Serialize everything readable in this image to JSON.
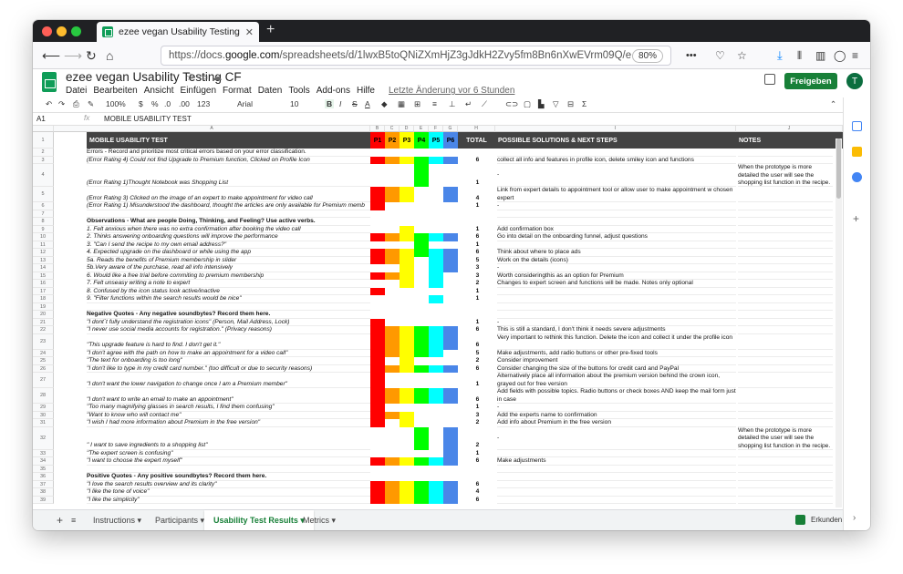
{
  "browser": {
    "tab_title": "ezee vegan Usability Testing CF",
    "url_prefix": "https://docs.",
    "url_domain": "google.com",
    "url_rest": "/spreadsheets/d/1lwxB5toQNiZXmHjZ3gJdkH2Zvy5fm8Bn6nXwEVrm09Q/e",
    "zoom": "80%"
  },
  "sheets": {
    "doc_title": "ezee vegan Usability Testing CF",
    "menus": [
      "Datei",
      "Bearbeiten",
      "Ansicht",
      "Einfügen",
      "Format",
      "Daten",
      "Tools",
      "Add-ons",
      "Hilfe"
    ],
    "last_edit": "Letzte Änderung vor 6 Stunden",
    "share_label": "Freigeben",
    "avatar_letter": "T",
    "toolbar_zoom": "100%",
    "toolbar_currency": "$",
    "toolbar_percent": "%",
    "toolbar_dec": ".0",
    "toolbar_dec2": ".00",
    "toolbar_fmt": "123",
    "font_name": "Arial",
    "font_size": "10",
    "bold": "B",
    "italic": "I",
    "strike": "S",
    "text_color": "A",
    "cell_ref": "A1",
    "formula_value": "MOBILE USABILITY TEST"
  },
  "grid": {
    "col_letters": [
      "A",
      "B",
      "C",
      "D",
      "E",
      "F",
      "G",
      "H",
      "I",
      "J"
    ],
    "headers": {
      "a": "MOBILE USABILITY TEST",
      "p": [
        "P1",
        "P2",
        "P3",
        "P4",
        "P5",
        "P6"
      ],
      "total": "TOTAL",
      "solutions": "POSSIBLE SOLUTIONS & NEXT STEPS",
      "notes": "NOTES"
    },
    "p_colors": [
      "#ff0000",
      "#ff9900",
      "#ffff00",
      "#00ff00",
      "#00ffff",
      "#4a86e8"
    ],
    "rows": [
      {
        "n": "2",
        "a": "Errors - Record and prioritize most critical errors based on your error classification.",
        "a_bold_prefix": "Errors",
        "p": [],
        "t": "",
        "i": "",
        "j": "",
        "h": 8.5
      },
      {
        "n": "3",
        "a": "(Error Rating 4) Could not find Upgrade to Premium function, Clicked on Profile Icon",
        "it": true,
        "p": [
          1,
          1,
          1,
          1,
          1,
          1
        ],
        "t": "6",
        "i": "collect all info and features in profile icon, delete smiley icon and functions",
        "j": "",
        "h": 8.5
      },
      {
        "n": "4",
        "a": "(Error Rating 1)Thought Notebook was Shopping List",
        "it": true,
        "p": [
          0,
          0,
          0,
          1,
          0,
          0
        ],
        "t": "1",
        "i": "-",
        "j": "When the prototype is more detailed the user will see the shopping list function in the recipe.",
        "h": 25
      },
      {
        "n": "5",
        "a": "(Error Rating 3) Clicked on the image of an expert to make appointment for video call",
        "it": true,
        "p": [
          1,
          1,
          1,
          0,
          0,
          1
        ],
        "t": "4",
        "i": "Link from expert details to appointment tool or allow user to make appointment w chosen expert",
        "j": "",
        "h": 17
      },
      {
        "n": "6",
        "a": "(Error Rating 1) Misunderstood the dashboard, thought the articles are only available for Premium memb",
        "it": true,
        "p": [
          1,
          0,
          0,
          0,
          0,
          0
        ],
        "t": "1",
        "i": "-",
        "j": "",
        "h": 8.5
      },
      {
        "n": "7",
        "a": "",
        "p": [],
        "t": "",
        "i": "",
        "j": "",
        "h": 8.5
      },
      {
        "n": "8",
        "a": "Observations - What are people Doing, Thinking, and Feeling? Use active verbs.",
        "b": true,
        "p": [],
        "t": "",
        "i": "",
        "j": "",
        "h": 8.5
      },
      {
        "n": "9",
        "a": "1. Felt anxious when there was no extra confirmation after booking the video call",
        "it": true,
        "p": [
          0,
          0,
          1,
          0,
          0,
          0
        ],
        "t": "1",
        "i": "Add confirmation box",
        "j": "",
        "h": 8.5
      },
      {
        "n": "10",
        "a": "2. Thinks answering onboarding questions will improve the performance",
        "it": true,
        "p": [
          1,
          1,
          1,
          1,
          1,
          1
        ],
        "t": "6",
        "i": "Go into detail on the onboarding funnel, adjust questions",
        "j": "",
        "h": 8.5
      },
      {
        "n": "11",
        "a": "3. \"Can I send the recipe to my own email address?\"",
        "it": true,
        "p": [
          0,
          0,
          0,
          1,
          0,
          0
        ],
        "t": "1",
        "i": "",
        "j": "",
        "h": 8.5
      },
      {
        "n": "12",
        "a": "4. Expected upgrade on the dashboard or while using the app",
        "it": true,
        "p": [
          1,
          1,
          1,
          1,
          1,
          1
        ],
        "t": "6",
        "i": "Think about where to place ads",
        "j": "",
        "h": 8.5
      },
      {
        "n": "13",
        "a": "5a. Reads the benefits of Premium membership in slider",
        "it": true,
        "p": [
          1,
          1,
          1,
          0,
          1,
          1
        ],
        "t": "5",
        "i": "Work on the details (icons)",
        "j": "",
        "h": 8.5
      },
      {
        "n": "14",
        "a": "5b.Very aware of the purchase, read all info intensively",
        "it": true,
        "p": [
          0,
          0,
          1,
          0,
          1,
          1
        ],
        "t": "3",
        "i": "-",
        "j": "",
        "h": 8.5
      },
      {
        "n": "15",
        "a": "6. Would like a free trial before commiting to premium membership",
        "it": true,
        "p": [
          1,
          1,
          1,
          0,
          1,
          0
        ],
        "t": "3",
        "i": "Worth consideringthis as an option for Premium",
        "j": "",
        "h": 8.5
      },
      {
        "n": "16",
        "a": "7. Felt unseasy writing a note to expert",
        "it": true,
        "p": [
          0,
          0,
          1,
          0,
          1,
          0
        ],
        "t": "2",
        "i": "Changes to expert screen and functions will be made. Notes only optional",
        "j": "",
        "h": 8.5
      },
      {
        "n": "17",
        "a": "8. Confused by the icon status look active/inactive",
        "it": true,
        "p": [
          1,
          0,
          0,
          0,
          0,
          0
        ],
        "t": "1",
        "i": "",
        "j": "",
        "h": 8.5
      },
      {
        "n": "18",
        "a": "9. \"Filter functions within the search results would be nice\"",
        "it": true,
        "p": [
          0,
          0,
          0,
          0,
          1,
          0
        ],
        "t": "1",
        "i": "",
        "j": "",
        "h": 8.5
      },
      {
        "n": "19",
        "a": "",
        "p": [],
        "t": "",
        "i": "",
        "j": "",
        "h": 8.5
      },
      {
        "n": "20",
        "a": "Negative Quotes - Any negative soundbytes? Record them here.",
        "b": true,
        "p": [],
        "t": "",
        "i": "",
        "j": "",
        "h": 8.5
      },
      {
        "n": "21",
        "a": "\"I dont´t fully understand the registration icons\" (Person, Mail Address, Lock)",
        "it": true,
        "p": [
          1,
          0,
          0,
          0,
          0,
          0
        ],
        "t": "1",
        "i": "-",
        "j": "",
        "h": 8.5
      },
      {
        "n": "22",
        "a": "\"I never use social media accounts for registration.\" (Privacy reasons)",
        "it": true,
        "p": [
          1,
          1,
          1,
          1,
          1,
          1
        ],
        "t": "6",
        "i": "This is still a standard, I don't think it needs severe adjustments",
        "j": "",
        "h": 8.5
      },
      {
        "n": "23",
        "a": "\"This upgrade feature is hard to find. I don't get it.\"",
        "it": true,
        "p": [
          1,
          1,
          1,
          1,
          1,
          1
        ],
        "t": "6",
        "i": "Very important to rethink this function. Delete the icon and collect it under the profile icon",
        "j": "",
        "h": 17
      },
      {
        "n": "24",
        "a": "\"I don't agree with the path on how to make an appointment for a video call\"",
        "it": true,
        "p": [
          1,
          1,
          1,
          1,
          1,
          0
        ],
        "t": "5",
        "i": "Make adjustments, add radio buttons or other pre-fixed tools",
        "j": "",
        "h": 8.5
      },
      {
        "n": "25",
        "a": "\"The text for onboarding is too long\"",
        "it": true,
        "p": [
          1,
          0,
          1,
          0,
          0,
          0
        ],
        "t": "2",
        "i": "Consider improvement",
        "j": "",
        "h": 8.5
      },
      {
        "n": "26",
        "a": "\"I don't like to type in my credit card number.\" (too difficult or due to security reasons)",
        "it": true,
        "p": [
          1,
          1,
          1,
          1,
          1,
          1
        ],
        "t": "6",
        "i": "Consider changing the size of the buttons for credit card and PayPal",
        "j": "",
        "h": 8.5
      },
      {
        "n": "27",
        "a": "\"I don't want the lower navigation to change once I am a Premium member\"",
        "it": true,
        "p": [
          1,
          0,
          0,
          0,
          0,
          0
        ],
        "t": "1",
        "i": "Alternatively place all information about the premium version behind the crown icon, grayed out for free version",
        "j": "",
        "h": 17
      },
      {
        "n": "28",
        "a": "\"I don't want to write an email to make an appointment\"",
        "it": true,
        "p": [
          1,
          1,
          1,
          1,
          1,
          1
        ],
        "t": "6",
        "i": "Add fields with possible topics. Radio buttons or check boxes AND keep the mail form just in case",
        "j": "",
        "h": 17
      },
      {
        "n": "29",
        "a": "\"Too many magnifying glasses in search results, I find them confusing\"",
        "it": true,
        "p": [
          1,
          0,
          0,
          0,
          0,
          0
        ],
        "t": "1",
        "i": "-",
        "j": "",
        "h": 8.5
      },
      {
        "n": "30",
        "a": "\"Want to know who will contact me\"",
        "it": true,
        "p": [
          1,
          1,
          1,
          0,
          0,
          0
        ],
        "t": "3",
        "i": "Add the experts name to confirmation",
        "j": "",
        "h": 8.5
      },
      {
        "n": "31",
        "a": "\"I wish I had more information about Premium in the free version\"",
        "it": true,
        "p": [
          1,
          0,
          1,
          0,
          0,
          0
        ],
        "t": "2",
        "i": "Add info about Premium in the free version",
        "j": "",
        "h": 8.5
      },
      {
        "n": "32",
        "a": "\" I want to save ingredients to a shopping list\"",
        "it": true,
        "p": [
          0,
          0,
          0,
          1,
          0,
          1
        ],
        "t": "2",
        "i": "-",
        "j": "When the prototype is more detailed the user will see the shopping list function in the recipe.",
        "h": 25
      },
      {
        "n": "33",
        "a": "\"The expert screen is confusing\"",
        "it": true,
        "p": [
          0,
          0,
          0,
          0,
          0,
          1
        ],
        "t": "1",
        "i": "",
        "j": "",
        "h": 8.5
      },
      {
        "n": "34",
        "a": "\"I want to choose the expert myself\"",
        "it": true,
        "p": [
          1,
          1,
          1,
          1,
          1,
          1
        ],
        "t": "6",
        "i": "Make adjustments",
        "j": "",
        "h": 8.5
      },
      {
        "n": "35",
        "a": "",
        "p": [],
        "t": "",
        "i": "",
        "j": "",
        "h": 8.5
      },
      {
        "n": "36",
        "a": "Positive Quotes - Any positive soundbytes? Record them here.",
        "b": true,
        "p": [],
        "t": "",
        "i": "",
        "j": "",
        "h": 8.5
      },
      {
        "n": "37",
        "a": "\"I love the search results overview and its clarity\"",
        "it": true,
        "p": [
          1,
          1,
          1,
          1,
          1,
          1
        ],
        "t": "6",
        "i": "",
        "j": "",
        "h": 8.5
      },
      {
        "n": "38",
        "a": "\"I like the tone of voice\"",
        "it": true,
        "p": [
          1,
          1,
          1,
          1,
          1,
          1
        ],
        "t": "4",
        "i": "",
        "j": "",
        "h": 8.5
      },
      {
        "n": "39",
        "a": "\"I like the simplicity\"",
        "it": true,
        "p": [
          1,
          1,
          1,
          1,
          1,
          1
        ],
        "t": "6",
        "i": "",
        "j": "",
        "h": 8.5
      }
    ]
  },
  "sheet_tabs": {
    "add": "+",
    "list": "≡",
    "tabs": [
      "Instructions",
      "Participants",
      "Usability Test Results",
      "Metrics"
    ],
    "active": 2,
    "explore": "Erkunden"
  }
}
